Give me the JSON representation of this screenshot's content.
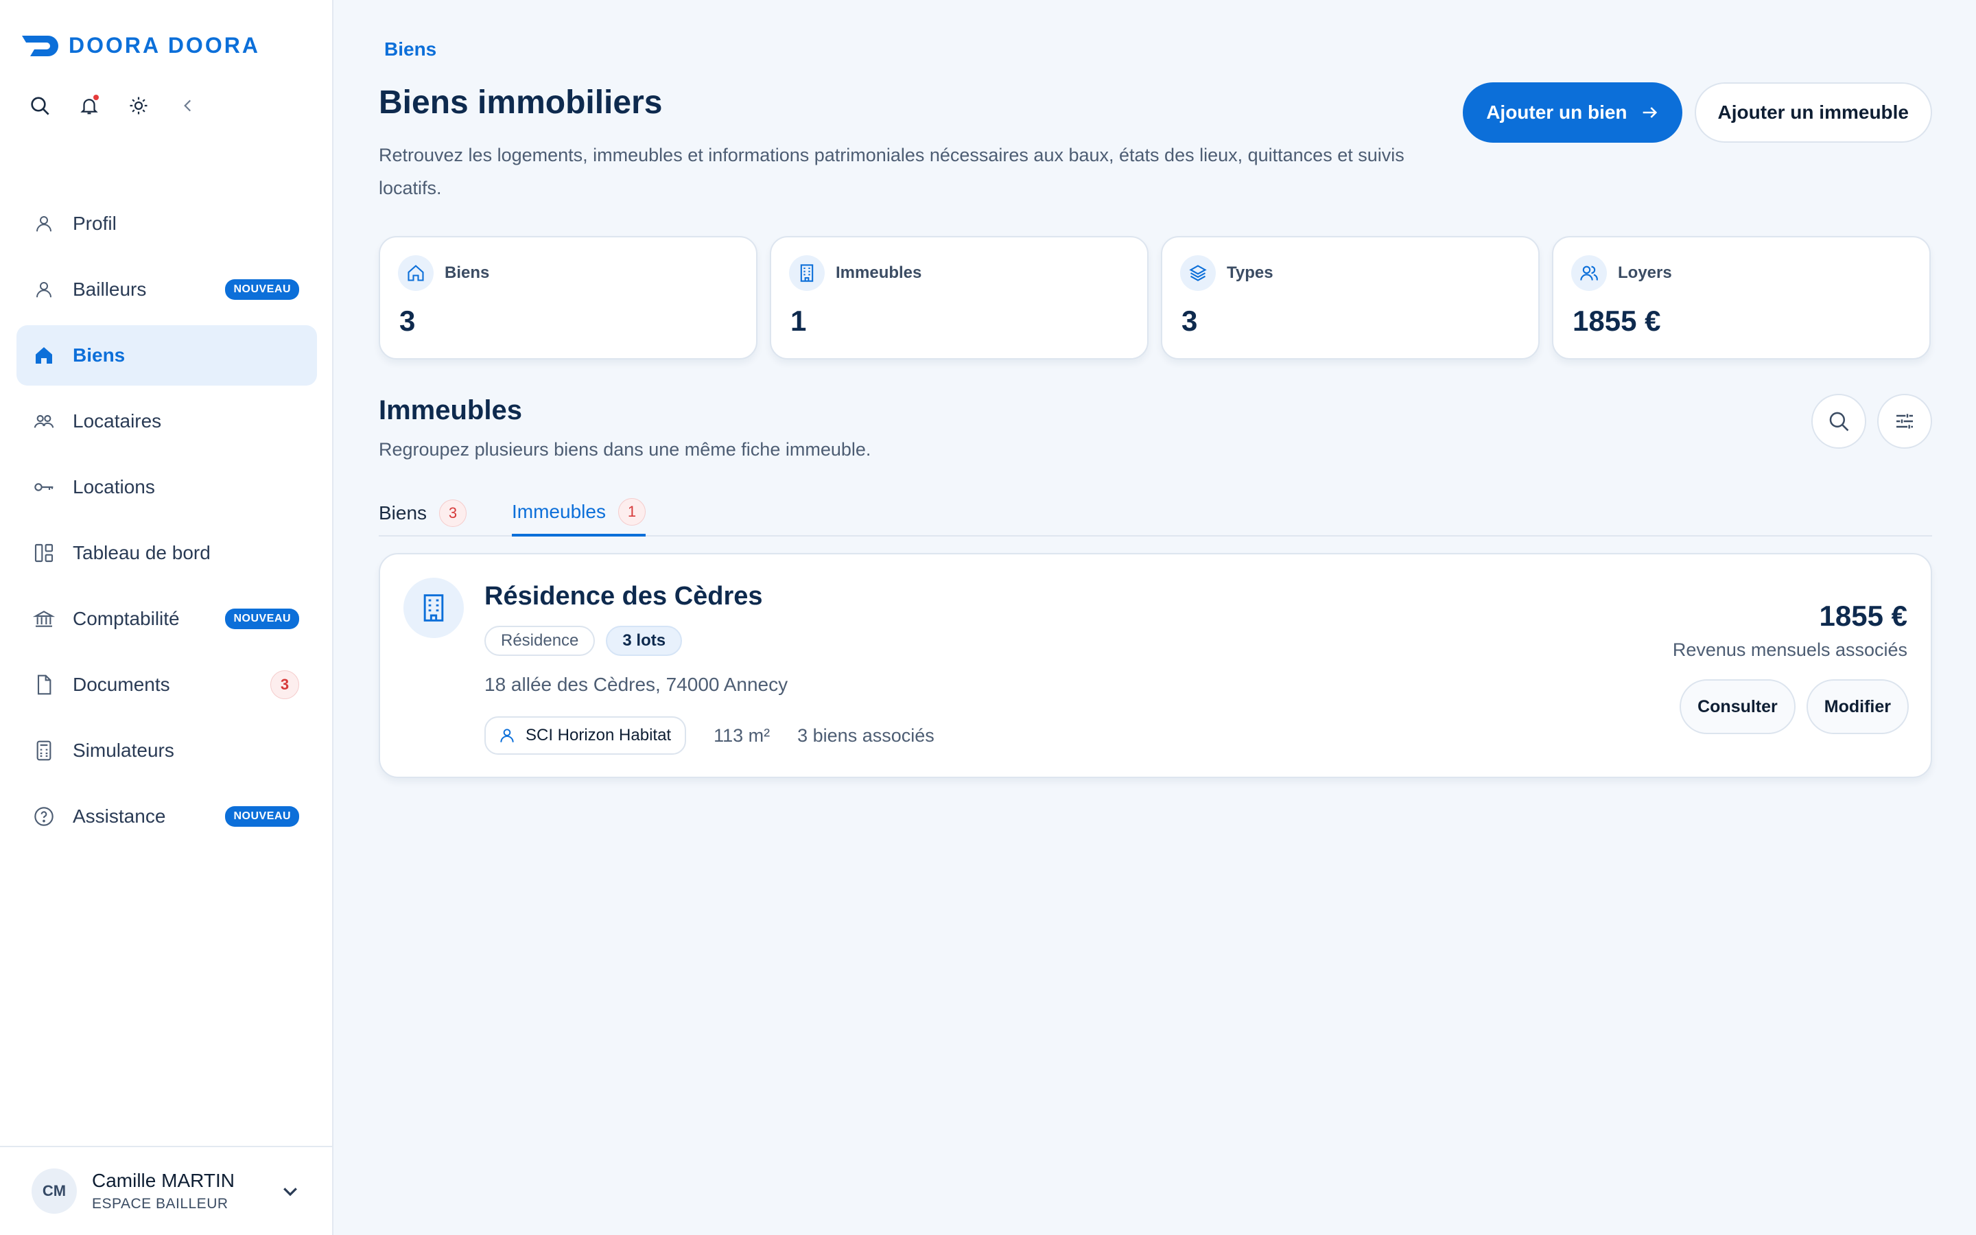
{
  "brand": {
    "name": "DOORA DOORA"
  },
  "sidebar": {
    "items": [
      {
        "label": "Profil",
        "icon": "user-icon"
      },
      {
        "label": "Bailleurs",
        "icon": "user-icon",
        "badge": "NOUVEAU"
      },
      {
        "label": "Biens",
        "icon": "home-icon",
        "active": true
      },
      {
        "label": "Locataires",
        "icon": "users-icon"
      },
      {
        "label": "Locations",
        "icon": "key-icon"
      },
      {
        "label": "Tableau de bord",
        "icon": "dashboard-icon"
      },
      {
        "label": "Comptabilité",
        "icon": "bank-icon",
        "badge": "NOUVEAU"
      },
      {
        "label": "Documents",
        "icon": "document-icon",
        "count": "3"
      },
      {
        "label": "Simulateurs",
        "icon": "calculator-icon"
      },
      {
        "label": "Assistance",
        "icon": "help-icon",
        "badge": "NOUVEAU"
      }
    ]
  },
  "user": {
    "initials": "CM",
    "name": "Camille MARTIN",
    "role": "ESPACE BAILLEUR"
  },
  "header": {
    "breadcrumb": "Biens",
    "title": "Biens immobiliers",
    "description": "Retrouvez les logements, immeubles et informations patrimoniales nécessaires aux baux, états des lieux, quittances et suivis locatifs.",
    "primary_action": "Ajouter un bien",
    "secondary_action": "Ajouter un immeuble"
  },
  "stats": [
    {
      "label": "Biens",
      "value": "3",
      "icon": "home-icon"
    },
    {
      "label": "Immeubles",
      "value": "1",
      "icon": "building-icon"
    },
    {
      "label": "Types",
      "value": "3",
      "icon": "layers-icon"
    },
    {
      "label": "Loyers",
      "value": "1855 €",
      "icon": "users-icon"
    }
  ],
  "section": {
    "title": "Immeubles",
    "subtitle": "Regroupez plusieurs biens dans une même fiche immeuble."
  },
  "tabs": [
    {
      "label": "Biens",
      "count": "3",
      "active": false
    },
    {
      "label": "Immeubles",
      "count": "1",
      "active": true
    }
  ],
  "building": {
    "name": "Résidence des Cèdres",
    "type_chip": "Résidence",
    "lots_chip": "3 lots",
    "address": "18 allée des Cèdres, 74000 Annecy",
    "owner": "SCI Horizon Habitat",
    "surface": "113 m²",
    "linked": "3 biens associés",
    "amount": "1855 €",
    "amount_label": "Revenus mensuels associés",
    "consult": "Consulter",
    "edit": "Modifier"
  },
  "colors": {
    "accent": "#0c6fd9",
    "text": "#0e2a4e",
    "background": "#f3f7fc",
    "alert": "#d63a3a"
  }
}
